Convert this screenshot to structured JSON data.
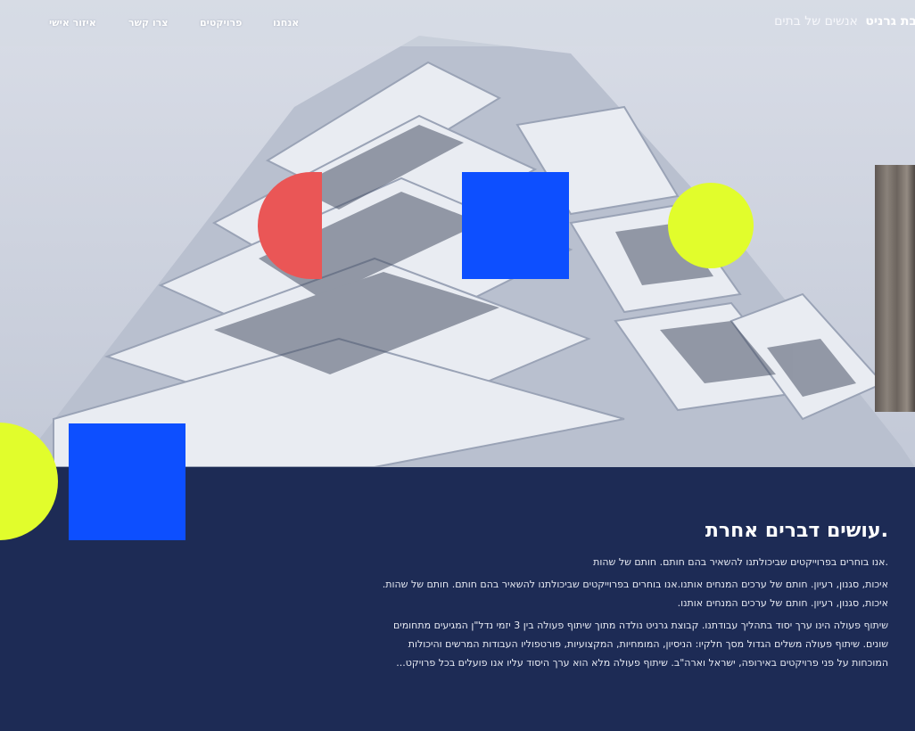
{
  "nav": {
    "brand_name": "בת גרניט",
    "brand_tagline": "אנשים של בתים",
    "links": [
      "אנחנו",
      "פרויקטים",
      "צרו קשר",
      "איזור אישי"
    ]
  },
  "hero": {
    "image": "building-facade-photo",
    "shapes": [
      {
        "kind": "half-circle",
        "color": "#ea5656"
      },
      {
        "kind": "square",
        "color": "#0d4fff"
      },
      {
        "kind": "circle",
        "color": "#e1fd2c"
      },
      {
        "kind": "circle",
        "color": "#e1fd2c"
      },
      {
        "kind": "square",
        "color": "#0d4fff"
      }
    ]
  },
  "about": {
    "heading": ".עושים דברים אחרת",
    "p1": ".אנו בוחרים בפרוייקטים שביכולתנו להשאיר בהם חותם. חותם של שהות",
    "p2": "איכות, סגנון, רעיון. חותם של ערכים המנחים אותנו.אנו בוחרים בפרוייקטים שביכולתנו להשאיר בהם חותם. חותם של שהות. איכות, סגנון, רעיון. חותם של ערכים המנחים אותנו.",
    "p3": "שיתוף פעולה הינו ערך יסוד בתהליך עבודתנו. קבוצת גרניט נולדה מתוך שיתוף פעולה בין 3 יזמי נדל\"ן המגיעים מתחומים שונים. שיתוף פעולה משלים הגדול מסך חלקיו: הניסיון, המומחיות, המקצועיות, פורטפוליו העבודות המרשים והיכולות המוכחות על פני פרויקטים באירופה, ישראל וארה\"ב. שיתוף פעולה מלא הוא ערך היסוד עליו אנו פועלים בכל פרויקט..."
  },
  "colors": {
    "accent_blue": "#0d4fff",
    "accent_yellow": "#e1fd2c",
    "accent_red": "#ea5656",
    "navy": "#1d2b55"
  }
}
